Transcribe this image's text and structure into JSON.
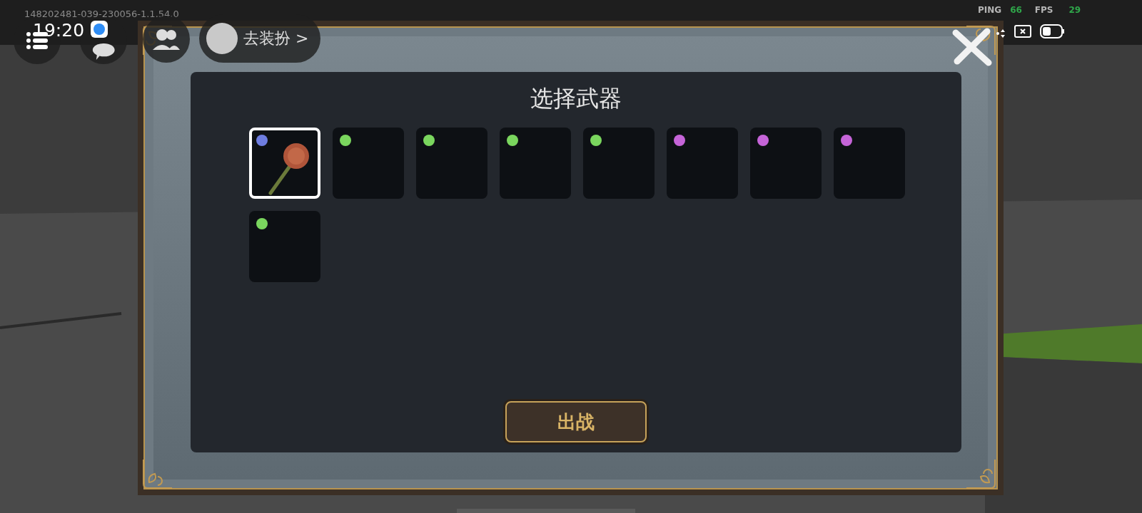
{
  "debug_text": "148202481-039-230056-1.1.54.0",
  "status_bar": {
    "time": "19:20",
    "ping_label": "PING",
    "ping": "66",
    "fps_label": "FPS",
    "fps": "29"
  },
  "hud": {
    "dress_up": "去装扮 >"
  },
  "dialog": {
    "title": "选择武器",
    "slots": [
      {
        "kind": "weapon",
        "color": "#6e7de0",
        "selected": true
      },
      {
        "kind": "empty",
        "color": "#7ad65e",
        "selected": false
      },
      {
        "kind": "empty",
        "color": "#7ad65e",
        "selected": false
      },
      {
        "kind": "empty",
        "color": "#7ad65e",
        "selected": false
      },
      {
        "kind": "empty",
        "color": "#7ad65e",
        "selected": false
      },
      {
        "kind": "empty",
        "color": "#c564d8",
        "selected": false
      },
      {
        "kind": "empty",
        "color": "#c564d8",
        "selected": false
      },
      {
        "kind": "empty",
        "color": "#c564d8",
        "selected": false
      },
      {
        "kind": "empty",
        "color": "#7ad65e",
        "selected": false
      }
    ],
    "confirm_button": "出战"
  }
}
